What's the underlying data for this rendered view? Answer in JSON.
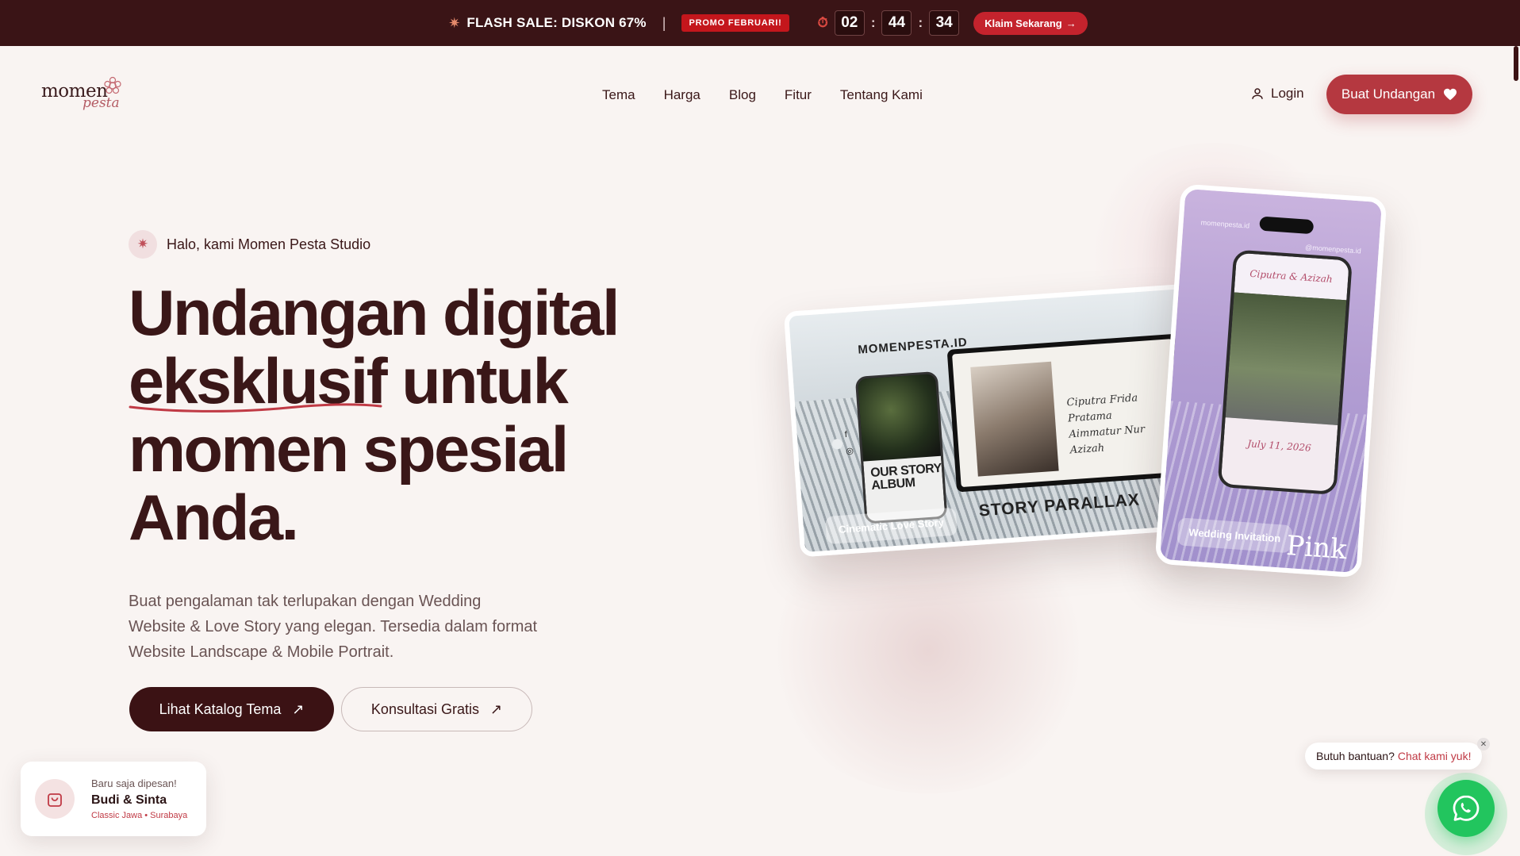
{
  "promo": {
    "flash_text": "FLASH SALE: DISKON 67%",
    "separator": "|",
    "badge": "PROMO FEBRUARI!",
    "countdown": {
      "hours": "02",
      "minutes": "44",
      "seconds": "34",
      "colon": ":"
    },
    "claim_label": "Klaim Sekarang"
  },
  "logo": {
    "word": "momen",
    "script": "pesta"
  },
  "nav": {
    "links": [
      "Tema",
      "Harga",
      "Blog",
      "Fitur",
      "Tentang Kami"
    ],
    "login_label": "Login",
    "cta_label": "Buat Undangan"
  },
  "hero": {
    "eyebrow": "Halo, kami Momen Pesta Studio",
    "headline": {
      "line1": "Undangan digital",
      "highlight": "eksklusif",
      "line2_rest": " untuk",
      "line3": "momen spesial",
      "line4": "Anda."
    },
    "lead": "Buat pengalaman tak terlupakan dengan Wedding Website & Love Story yang elegan. Tersedia dalam format Website Landscape & Mobile Portrait.",
    "primary_label": "Lihat Katalog Tema",
    "secondary_label": "Konsultasi Gratis"
  },
  "mockups": {
    "landscape": {
      "brand": "MOMENPESTA.ID",
      "story_title": "OUR STORY ALBUM",
      "names_line1": "Ciputra Frida Pratama",
      "names_line2": "Aimmatur Nur Azizah",
      "parallax": "STORY PARALLAX",
      "pill": "Cinematic Love Story"
    },
    "portrait": {
      "tag_left": "momenpesta.id",
      "tag_right": "@momenpesta.id",
      "couple": "Ciputra & Azizah",
      "date": "July 11, 2026",
      "word": "Pink",
      "pill": "Wedding Invitation"
    }
  },
  "order_toast": {
    "kicker": "Baru saja dipesan!",
    "name": "Budi & Sinta",
    "meta": "Classic Jawa • Surabaya"
  },
  "help": {
    "question": "Butuh bantuan?",
    "link": "Chat kami yuk!"
  },
  "colors": {
    "promo_bg": "#3a1416",
    "brand_red": "#b53840",
    "dark_maroon": "#3b1214",
    "page_bg": "#f9f4f2",
    "whatsapp": "#22c55e"
  },
  "icons": {
    "flash": "sparkle-icon",
    "timer": "stopwatch-icon",
    "claim": "arrow-right-icon",
    "login": "user-icon",
    "cta": "heart-icon",
    "eyebrow": "sparkle-icon",
    "buttons": "arrow-up-right-icon",
    "order": "shopping-bag-icon",
    "chat": "whatsapp-icon"
  }
}
